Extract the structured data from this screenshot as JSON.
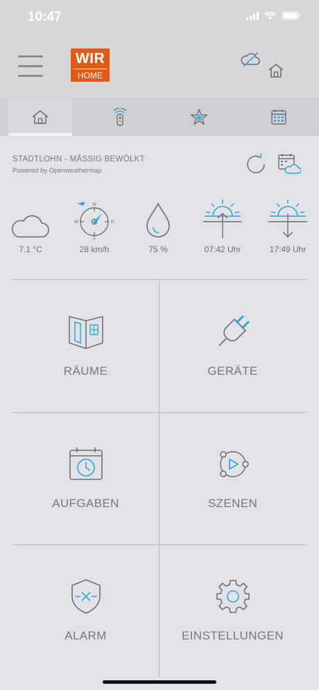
{
  "status_bar": {
    "time": "10:47"
  },
  "header": {
    "logo_line1": "WIR",
    "logo_line2": "HOME",
    "brand_color": "#e25a14"
  },
  "tabs": [
    {
      "name": "home",
      "icon": "home-icon",
      "active": true
    },
    {
      "name": "remote",
      "icon": "remote-control-icon",
      "active": false
    },
    {
      "name": "favorites",
      "icon": "star-icon",
      "active": false
    },
    {
      "name": "calendar",
      "icon": "calendar-icon",
      "active": false
    }
  ],
  "weather": {
    "location_status": "STADTLOHN - MÄSSIG BEWÖLKT",
    "powered_by": "Powered by Openweathermap",
    "temperature": "7.1 °C",
    "wind": "28 km/h",
    "humidity": "75 %",
    "sunrise": "07:42 Uhr",
    "sunset": "17:49 Uhr",
    "accent_color": "#2ca5dc"
  },
  "tiles": {
    "rooms": "RÄUME",
    "devices": "GERÄTE",
    "tasks": "AUFGABEN",
    "scenes": "SZENEN",
    "alarm": "ALARM",
    "settings": "EINSTELLUNGEN"
  }
}
